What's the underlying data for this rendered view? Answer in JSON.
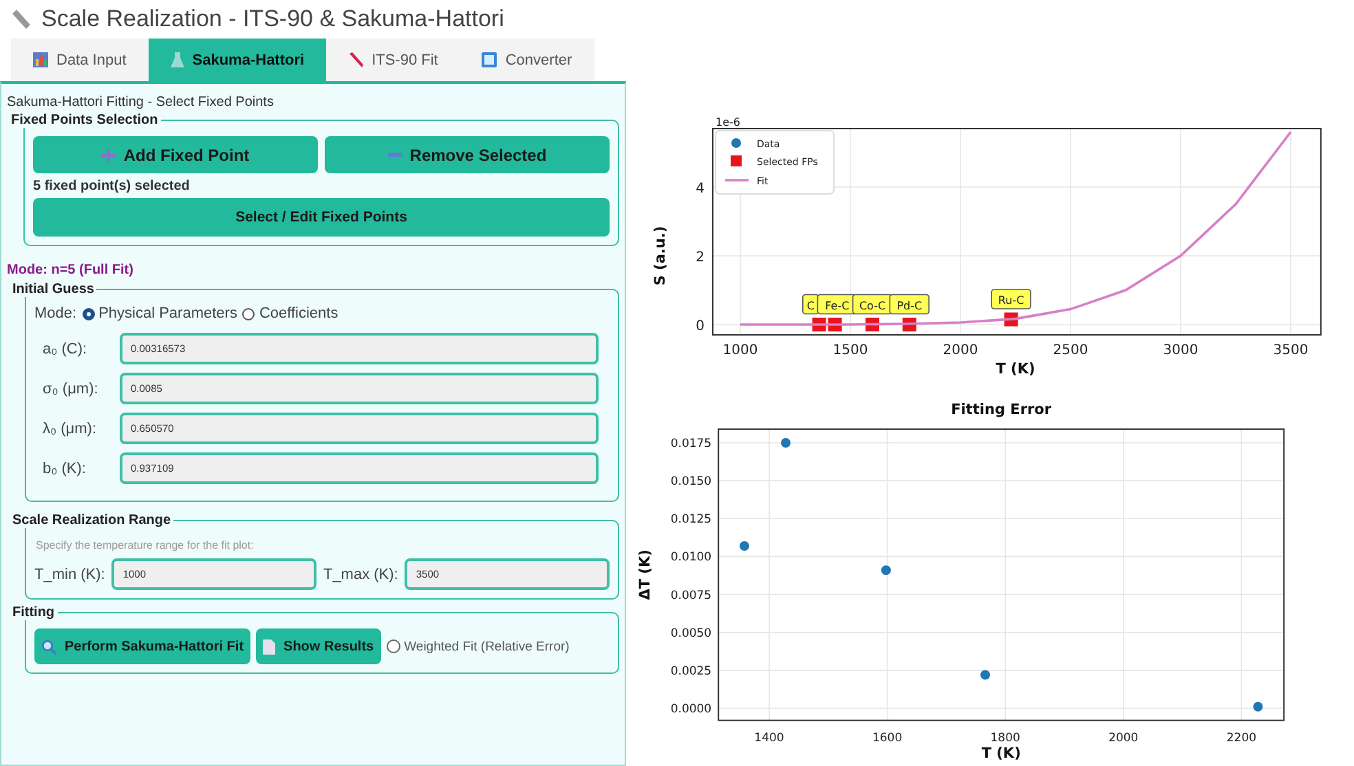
{
  "window": {
    "title": "Scale Realization - ITS-90 & Sakuma-Hattori"
  },
  "tabs": [
    {
      "label": "Data Input",
      "selected": false
    },
    {
      "label": "Sakuma-Hattori",
      "selected": true
    },
    {
      "label": "ITS-90 Fit",
      "selected": false
    },
    {
      "label": "Converter",
      "selected": false
    }
  ],
  "panel": {
    "heading": "Sakuma-Hattori Fitting - Select Fixed Points",
    "fixed_points": {
      "legend": "Fixed Points Selection",
      "add_button": "Add Fixed Point",
      "remove_button": "Remove Selected",
      "status": "5 fixed point(s) selected",
      "edit_button": "Select / Edit Fixed Points"
    },
    "mode_status": "Mode: n=5 (Full Fit)",
    "initial_guess": {
      "legend": "Initial Guess",
      "mode_label": "Mode:",
      "modes": [
        {
          "label": "Physical Parameters",
          "selected": true
        },
        {
          "label": "Coefficients",
          "selected": false
        }
      ],
      "fields": [
        {
          "label": "a₀ (C):",
          "value": "0.00316573"
        },
        {
          "label": "σ₀ (μm):",
          "value": "0.0085"
        },
        {
          "label": "λ₀ (μm):",
          "value": "0.650570"
        },
        {
          "label": "b₀ (K):",
          "value": "0.937109"
        }
      ]
    },
    "range": {
      "legend": "Scale Realization Range",
      "hint": "Specify the temperature range for the fit plot:",
      "fields": [
        {
          "label": "T_min (K):",
          "value": "1000"
        },
        {
          "label": "T_max (K):",
          "value": "3500"
        }
      ]
    },
    "fitting": {
      "legend": "Fitting",
      "fit_button": "Perform Sakuma-Hattori Fit",
      "results_button": "Show Results",
      "weighted": {
        "label": "Weighted Fit (Relative Error)",
        "checked": false
      }
    }
  },
  "charts": [
    {
      "chart_data": {
        "type": "line",
        "xlabel": "T (K)",
        "ylabel": "S (a.u.)",
        "xlim": [
          875,
          3637
        ],
        "ylim": [
          -0.3,
          5.7
        ],
        "xticks": [
          1000,
          1500,
          2000,
          2500,
          3000,
          3500
        ],
        "yticks": [
          0,
          2,
          4
        ],
        "grid": true,
        "legend": "upper left",
        "series": [
          {
            "name": "Data",
            "color": "#1f77b4",
            "type": "scatter"
          },
          {
            "name": "Selected FPs",
            "color": "#e8141c",
            "type": "scatter",
            "x": [
              1358,
              1430,
              1600,
              1768,
              2230
            ],
            "values": [
              0,
              0,
              0,
              0,
              0.15
            ]
          },
          {
            "name": "Fit",
            "color": "#d87fc6",
            "type": "line",
            "x": [
              1000,
              1250,
              1500,
              1750,
              2000,
              2250,
              2500,
              2750,
              3000,
              3250,
              3500
            ],
            "values": [
              0,
              0,
              0,
              0.02,
              0.06,
              0.17,
              0.45,
              1.0,
              2.0,
              3.5,
              5.6
            ]
          }
        ],
        "annotations": [
          {
            "text": "1e-6"
          },
          {
            "text": "C",
            "x": 1320,
            "y": 0.55
          },
          {
            "text": "Fe-C",
            "x": 1440,
            "y": 0.55
          },
          {
            "text": "Co-C",
            "x": 1600,
            "y": 0.55
          },
          {
            "text": "Pd-C",
            "x": 1768,
            "y": 0.55
          },
          {
            "text": "Ru-C",
            "x": 2230,
            "y": 0.7
          }
        ]
      }
    },
    {
      "chart_data": {
        "type": "scatter",
        "title": "Fitting Error",
        "xlabel": "T (K)",
        "ylabel": "ΔT (K)",
        "xlim": [
          1314,
          2272
        ],
        "ylim": [
          -0.0008,
          0.0184
        ],
        "xticks": [
          1400,
          1600,
          1800,
          2000,
          2200
        ],
        "yticks": [
          {
            "value": 0,
            "label": "0.0000"
          },
          {
            "value": 0.0025,
            "label": "0.0025"
          },
          {
            "value": 0.005,
            "label": "0.0050"
          },
          {
            "value": 0.0075,
            "label": "0.0075"
          },
          {
            "value": 0.01,
            "label": "0.0100"
          },
          {
            "value": 0.0125,
            "label": "0.0125"
          },
          {
            "value": 0.015,
            "label": "0.0150"
          },
          {
            "value": 0.0175,
            "label": "0.0175"
          }
        ],
        "grid": true,
        "series": [
          {
            "color": "#1f77b4",
            "x": [
              1358,
              1428,
              1598,
              1766,
              2228
            ],
            "values": [
              0.0107,
              0.0175,
              0.0091,
              0.0022,
              0.0001
            ]
          }
        ]
      }
    }
  ]
}
